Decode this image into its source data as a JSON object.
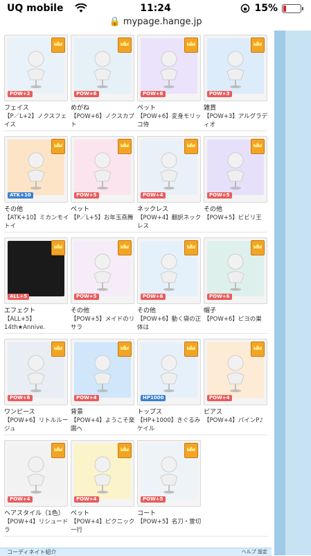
{
  "status": {
    "carrier": "UQ mobile",
    "time": "11:24",
    "battery": "15%",
    "battery_level": 0.15
  },
  "url": "mypage.hange.jp",
  "items": [
    {
      "name": "フェイス",
      "desc": "【P／L+2】ノクスフェイス",
      "badge": "POW+2",
      "bg": "#e9f2f8"
    },
    {
      "name": "めがね",
      "desc": "【POW+6】ノクスカプト",
      "badge": "POW+6",
      "bg": "#e6f0f7"
    },
    {
      "name": "ペット",
      "desc": "【POW+6】変身モリッコ侍",
      "badge": "POW+6",
      "bg": "#ebe2fb"
    },
    {
      "name": "雑貨",
      "desc": "【POW+3】アルグラディオ",
      "badge": "POW+3",
      "bg": "#dcecfb"
    },
    {
      "name": "その他",
      "desc": "【ATK+10】ミカンモイトイ",
      "badge": "ATK+10",
      "bg": "#fde4c6"
    },
    {
      "name": "ペット",
      "desc": "【P／L+5】お年玉燕舞",
      "badge": "POW+5",
      "bg": "#fbe4ee"
    },
    {
      "name": "ネックレス",
      "desc": "【POW+4】翻訳ネックレス",
      "badge": "POW+4",
      "bg": "#eaf0f7"
    },
    {
      "name": "その他",
      "desc": "【POW+5】ビビリ王",
      "badge": "POW+5",
      "bg": "#e6e0fb"
    },
    {
      "name": "エフェクト",
      "desc": "【ALL+5】14th★Annive.",
      "badge": "ALL+5",
      "bg": "#1a1a1a"
    },
    {
      "name": "その他",
      "desc": "【POW+5】メイドのリサラ",
      "badge": "POW+5",
      "bg": "#f6ecf7"
    },
    {
      "name": "その他",
      "desc": "【POW+6】動く袋の正体は",
      "badge": "POW+6",
      "bg": "#e5f1fa"
    },
    {
      "name": "帽子",
      "desc": "【POW+6】ピヨの巣",
      "badge": "POW+6",
      "bg": "#def0ec"
    },
    {
      "name": "ワンピース",
      "desc": "【POW+6】リトルルージュ",
      "badge": "POW+6",
      "bg": "#e9eef5"
    },
    {
      "name": "背景",
      "desc": "【POW+4】ようこそ楽園へ",
      "badge": "POW+4",
      "bg": "#cfe6fb"
    },
    {
      "name": "トップス",
      "desc": "【HP+1000】きぐるみケイル",
      "badge": "HP1000",
      "bg": "#e6f0fa"
    },
    {
      "name": "ピアス",
      "desc": "【POW+4】パインP♪",
      "badge": "POW+4",
      "bg": "#fdebd5"
    },
    {
      "name": "ヘアスタイル（1色）",
      "desc": "【POW+4】リシュードラ",
      "badge": "POW+4",
      "bg": "#f2f2f2"
    },
    {
      "name": "ペット",
      "desc": "【POW+4】ピクニック一行",
      "badge": "POW+4",
      "bg": "#fbf3c9"
    },
    {
      "name": "コート",
      "desc": "【POW+5】名刀・雷切",
      "badge": "POW+5",
      "bg": "#eef3f8"
    }
  ],
  "footer": {
    "label": "コーディネイト紹介",
    "help": "ヘルプ",
    "settings": "設定"
  }
}
